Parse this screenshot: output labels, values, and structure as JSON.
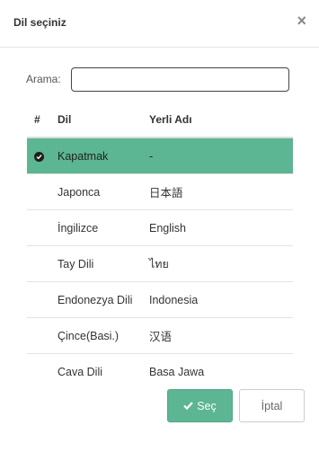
{
  "dialog": {
    "title": "Dil seçiniz",
    "close_label": "×"
  },
  "search": {
    "label": "Arama:",
    "value": "",
    "placeholder": ""
  },
  "table": {
    "headers": [
      "#",
      "Dil",
      "Yerli Adı"
    ],
    "rows": [
      {
        "lang": "Kapatmak",
        "native": "-",
        "selected": true
      },
      {
        "lang": "Japonca",
        "native": "日本語",
        "selected": false
      },
      {
        "lang": "İngilizce",
        "native": "English",
        "selected": false
      },
      {
        "lang": "Tay Dili",
        "native": "ไทย",
        "selected": false
      },
      {
        "lang": "Endonezya Dili",
        "native": "Indonesia",
        "selected": false
      },
      {
        "lang": "Çince(Basi.)",
        "native": "汉语",
        "selected": false
      },
      {
        "lang": "Cava Dili",
        "native": "Basa Jawa",
        "selected": false
      }
    ]
  },
  "buttons": {
    "select_label": "Seç",
    "cancel_label": "İptal"
  },
  "colors": {
    "accent": "#5cb593",
    "check": "#1e1e1e"
  },
  "icons": {
    "close": "close-icon",
    "selected_row": "check-circle-icon",
    "select_button": "check-icon"
  }
}
